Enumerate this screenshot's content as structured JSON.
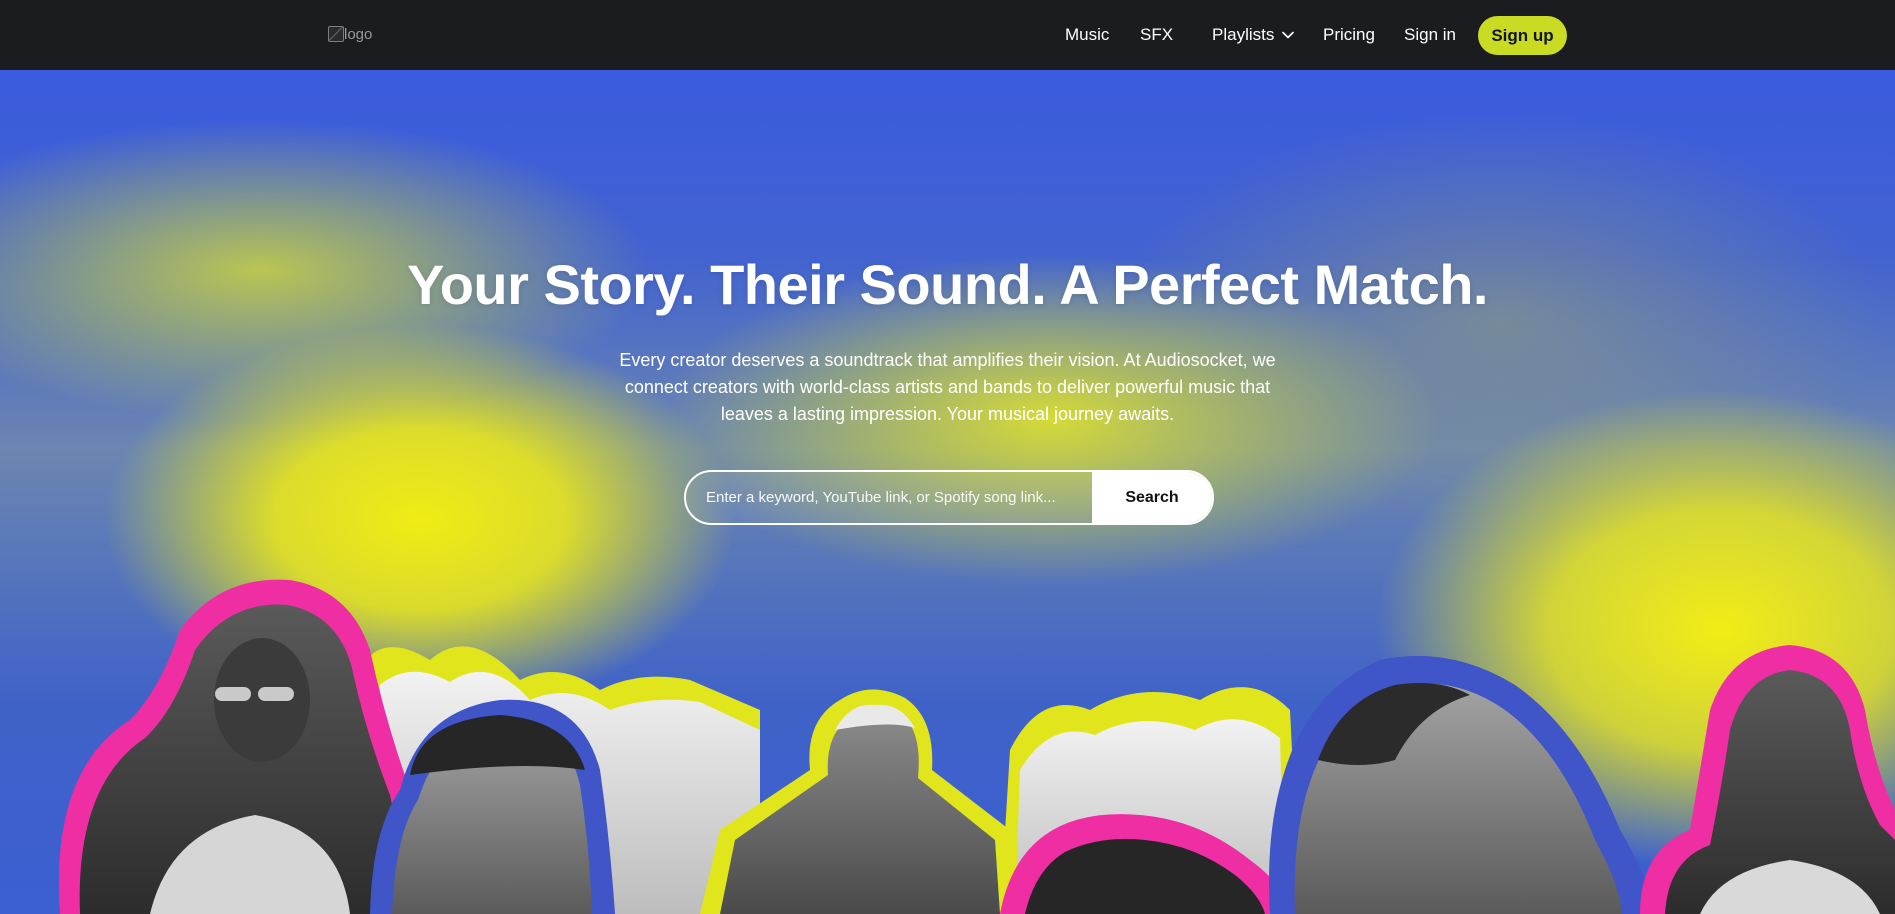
{
  "nav": {
    "logo_alt": "logo",
    "links": {
      "music": "Music",
      "sfx": "SFX",
      "playlists": "Playlists",
      "pricing": "Pricing",
      "signin": "Sign in"
    },
    "signup": "Sign up"
  },
  "hero": {
    "title": "Your Story. Their Sound. A Perfect Match.",
    "subtitle": "Every creator deserves a soundtrack that amplifies their vision. At Audiosocket, we connect creators with world-class artists and bands to deliver powerful music that leaves a lasting impression. Your musical journey awaits.",
    "search": {
      "placeholder": "Enter a keyword, YouTube link, or Spotify song link...",
      "button": "Search"
    }
  },
  "colors": {
    "nav_bg": "#1b1c1f",
    "accent": "#c9dc23",
    "outline_pink": "#f02ea4",
    "outline_blue": "#3f55c8",
    "outline_yellow": "#e1e51c"
  },
  "icons": {
    "playlists_dropdown": "chevron-down-icon"
  }
}
